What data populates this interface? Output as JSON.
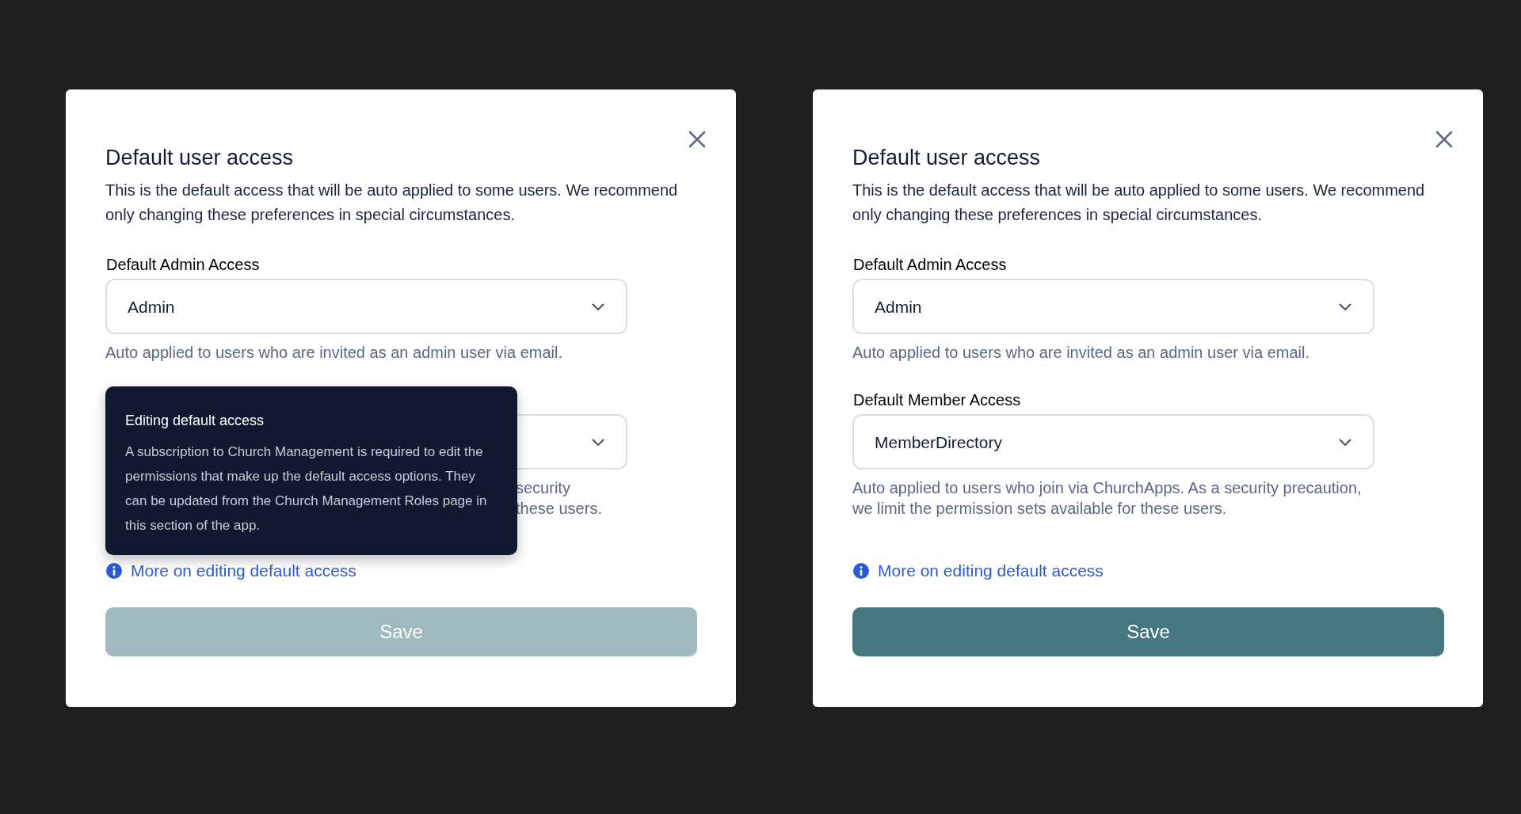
{
  "dialogs": [
    {
      "title": "Default user access",
      "intro": "This is the default access that will be auto applied to some users. We recommend only changing these preferences in special circumstances.",
      "fields": [
        {
          "kind": "full",
          "label": "Default Admin Access",
          "value": "Admin",
          "help": "Auto applied to users who are invited as an admin user via email."
        },
        {
          "kind": "covered",
          "help_fragments": [
            "security",
            "these users."
          ]
        }
      ],
      "link": "More on editing default access",
      "save": {
        "label": "Save",
        "disabled": true
      },
      "tooltip": {
        "title": "Editing default access",
        "body": "A subscription to Church Management is required to edit the permissions that make up the default access options. They can be updated from the Church Management Roles page in this section of the app."
      }
    },
    {
      "title": "Default user access",
      "intro": "This is the default access that will be auto applied to some users. We recommend only changing these preferences in special circumstances.",
      "fields": [
        {
          "kind": "full",
          "label": "Default Admin Access",
          "value": "Admin",
          "help": "Auto applied to users who are invited as an admin user via email."
        },
        {
          "kind": "full",
          "label": "Default Member Access",
          "value": "MemberDirectory",
          "help": "Auto applied to users who join via ChurchApps. As a security precaution, we limit the permission sets available for these users."
        }
      ],
      "link": "More on editing default access",
      "save": {
        "label": "Save",
        "disabled": false
      }
    }
  ]
}
